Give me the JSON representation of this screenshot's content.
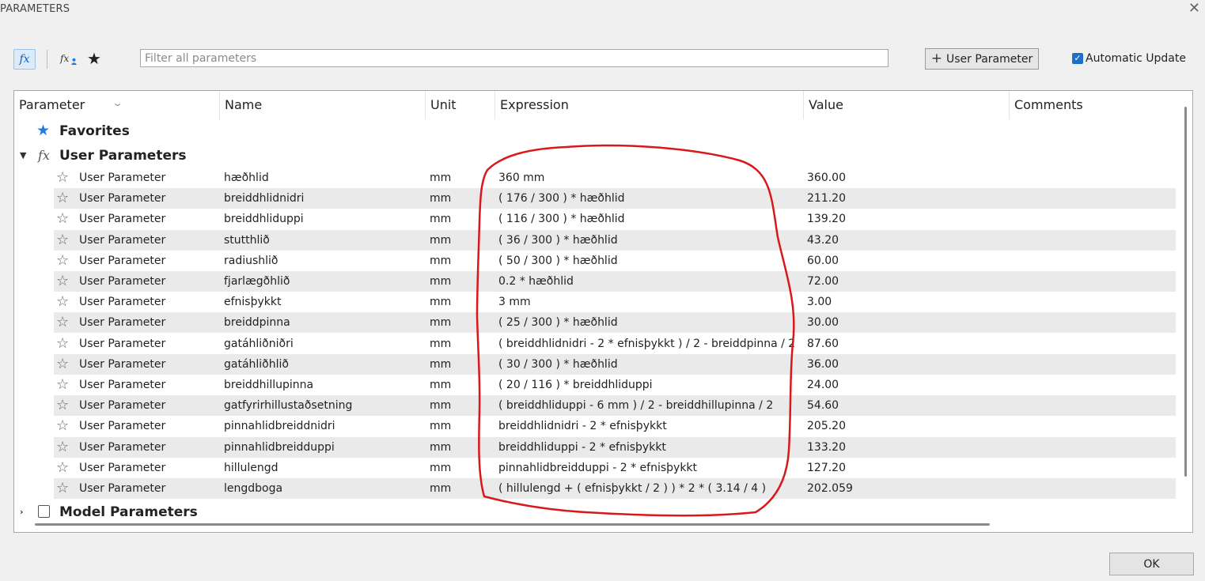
{
  "window": {
    "title": "PARAMETERS",
    "close_symbol": "✕"
  },
  "toolbar": {
    "fx_symbol": "fx",
    "fx_user_symbol": "fx",
    "star_symbol": "★",
    "filter_placeholder": "Filter all parameters",
    "filter_value": "",
    "add_user_parameter_label": "User Parameter",
    "add_symbol": "+",
    "automatic_update_label": "Automatic Update",
    "automatic_update_checked": true
  },
  "columns": [
    "Parameter",
    "Name",
    "Unit",
    "Expression",
    "Value",
    "Comments"
  ],
  "sections": {
    "favorites": {
      "label": "Favorites"
    },
    "user_parameters": {
      "label": "User Parameters",
      "expanded": true
    },
    "model_parameters": {
      "label": "Model Parameters",
      "expanded": false
    }
  },
  "rows": [
    {
      "parameter": "User Parameter",
      "name": "hæðhlid",
      "unit": "mm",
      "expression": "360 mm",
      "value": "360.00",
      "comments": ""
    },
    {
      "parameter": "User Parameter",
      "name": "breiddhlidnidri",
      "unit": "mm",
      "expression": "( 176 / 300 ) * hæðhlid",
      "value": "211.20",
      "comments": ""
    },
    {
      "parameter": "User Parameter",
      "name": "breiddhliduppi",
      "unit": "mm",
      "expression": "( 116 / 300 ) * hæðhlid",
      "value": "139.20",
      "comments": ""
    },
    {
      "parameter": "User Parameter",
      "name": "stutthlið",
      "unit": "mm",
      "expression": "( 36 / 300 ) * hæðhlid",
      "value": "43.20",
      "comments": ""
    },
    {
      "parameter": "User Parameter",
      "name": "radiushlið",
      "unit": "mm",
      "expression": "( 50 / 300 ) * hæðhlid",
      "value": "60.00",
      "comments": ""
    },
    {
      "parameter": "User Parameter",
      "name": "fjarlægðhlið",
      "unit": "mm",
      "expression": "0.2 * hæðhlid",
      "value": "72.00",
      "comments": ""
    },
    {
      "parameter": "User Parameter",
      "name": "efnisþykkt",
      "unit": "mm",
      "expression": "3 mm",
      "value": "3.00",
      "comments": ""
    },
    {
      "parameter": "User Parameter",
      "name": "breiddpinna",
      "unit": "mm",
      "expression": "( 25 / 300 ) * hæðhlid",
      "value": "30.00",
      "comments": ""
    },
    {
      "parameter": "User Parameter",
      "name": "gatáhliðniðri",
      "unit": "mm",
      "expression": "( breiddhlidnidri - 2 * efnisþykkt ) / 2 - breiddpinna / 2",
      "value": "87.60",
      "comments": ""
    },
    {
      "parameter": "User Parameter",
      "name": "gatáhliðhlið",
      "unit": "mm",
      "expression": "( 30 / 300 ) * hæðhlid",
      "value": "36.00",
      "comments": ""
    },
    {
      "parameter": "User Parameter",
      "name": "breiddhillupinna",
      "unit": "mm",
      "expression": "( 20 / 116 ) * breiddhliduppi",
      "value": "24.00",
      "comments": ""
    },
    {
      "parameter": "User Parameter",
      "name": "gatfyrirhillustaðsetning",
      "unit": "mm",
      "expression": "( breiddhliduppi - 6 mm ) / 2 - breiddhillupinna / 2",
      "value": "54.60",
      "comments": ""
    },
    {
      "parameter": "User Parameter",
      "name": "pinnahlidbreiddnidri",
      "unit": "mm",
      "expression": "breiddhlidnidri - 2 * efnisþykkt",
      "value": "205.20",
      "comments": ""
    },
    {
      "parameter": "User Parameter",
      "name": "pinnahlidbreidduppi",
      "unit": "mm",
      "expression": "breiddhliduppi - 2 * efnisþykkt",
      "value": "133.20",
      "comments": ""
    },
    {
      "parameter": "User Parameter",
      "name": "hillulengd",
      "unit": "mm",
      "expression": "pinnahlidbreidduppi - 2 * efnisþykkt",
      "value": "127.20",
      "comments": ""
    },
    {
      "parameter": "User Parameter",
      "name": "lengdboga",
      "unit": "mm",
      "expression": "( hillulengd + ( efnisþykkt / 2 ) ) * 2 * ( 3.14 / 4 )",
      "value": "202.059",
      "comments": ""
    }
  ],
  "footer": {
    "ok_label": "OK"
  },
  "colors": {
    "accent": "#1f7be0",
    "annotation": "#d9181b",
    "row_alt": "#eaeaea"
  }
}
